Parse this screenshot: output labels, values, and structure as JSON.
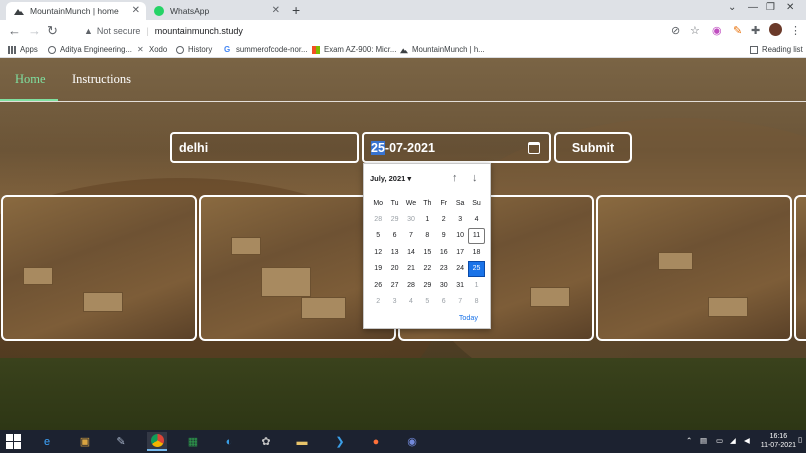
{
  "browser": {
    "tabs": [
      {
        "title": "MountainMunch | home",
        "active": true
      },
      {
        "title": "WhatsApp",
        "active": false
      }
    ],
    "new_tab": "+",
    "address": {
      "security": "Not secure",
      "url": "mountainmunch.study"
    },
    "bookmarks": [
      {
        "label": "Apps"
      },
      {
        "label": "Aditya Engineering..."
      },
      {
        "label": "Xodo"
      },
      {
        "label": "History"
      },
      {
        "label": "summerofcode-nor..."
      },
      {
        "label": "Exam AZ-900: Micr..."
      },
      {
        "label": "MountainMunch | h..."
      }
    ],
    "reading_list": "Reading list",
    "colors": {
      "accent": "#7fe0a0",
      "selected": "#1a73e8"
    }
  },
  "site": {
    "nav": [
      {
        "label": "Home",
        "active": true
      },
      {
        "label": "Instructions",
        "active": false
      }
    ],
    "search": {
      "location_value": "delhi",
      "date_selected_part": "25",
      "date_rest": "-07-2021",
      "submit_label": "Submit"
    }
  },
  "picker": {
    "month_label": "July, 2021 ▾",
    "weekdays": [
      "Mo",
      "Tu",
      "We",
      "Th",
      "Fr",
      "Sa",
      "Su"
    ],
    "weeks": [
      [
        "28",
        "29",
        "30",
        "1",
        "2",
        "3",
        "4"
      ],
      [
        "5",
        "6",
        "7",
        "8",
        "9",
        "10",
        "11"
      ],
      [
        "12",
        "13",
        "14",
        "15",
        "16",
        "17",
        "18"
      ],
      [
        "19",
        "20",
        "21",
        "22",
        "23",
        "24",
        "25"
      ],
      [
        "26",
        "27",
        "28",
        "29",
        "30",
        "31",
        "1"
      ],
      [
        "2",
        "3",
        "4",
        "5",
        "6",
        "7",
        "8"
      ]
    ],
    "today_day": "11",
    "selected_day": "25",
    "today_button": "Today"
  },
  "taskbar": {
    "time": "16:16",
    "date": "11-07-2021"
  }
}
